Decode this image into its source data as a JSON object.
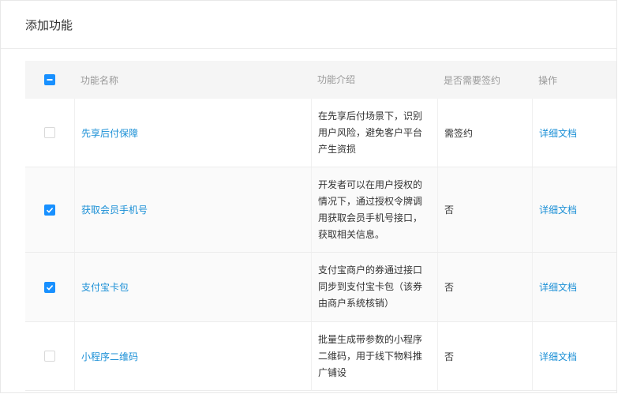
{
  "title": "添加功能",
  "table": {
    "headers": {
      "name": "功能名称",
      "desc": "功能介绍",
      "sign": "是否需要签约",
      "op": "操作"
    },
    "select_all_state": "indeterminate",
    "rows": [
      {
        "checked": false,
        "name": "先享后付保障",
        "desc": "在先享后付场景下，识别用户风险，避免客户平台产生资损",
        "sign": "需签约",
        "op": "详细文档"
      },
      {
        "checked": true,
        "name": "获取会员手机号",
        "desc": "开发者可以在用户授权的情况下，通过授权令牌调用获取会员手机号接口，获取相关信息。",
        "sign": "否",
        "op": "详细文档"
      },
      {
        "checked": true,
        "name": "支付宝卡包",
        "desc": "支付宝商户的券通过接口同步到支付宝卡包（该券由商户系统核销）",
        "sign": "否",
        "op": "详细文档"
      },
      {
        "checked": false,
        "name": "小程序二维码",
        "desc": "批量生成带参数的小程序二维码，用于线下物料推广铺设",
        "sign": "否",
        "op": "详细文档"
      }
    ]
  },
  "colors": {
    "link": "#1a8fd6",
    "checkbox_on": "#1890ff",
    "header_bg": "#f5f5f5"
  },
  "icons": {
    "checkbox_checked": "check-icon",
    "checkbox_indeterminate": "minus-icon"
  }
}
